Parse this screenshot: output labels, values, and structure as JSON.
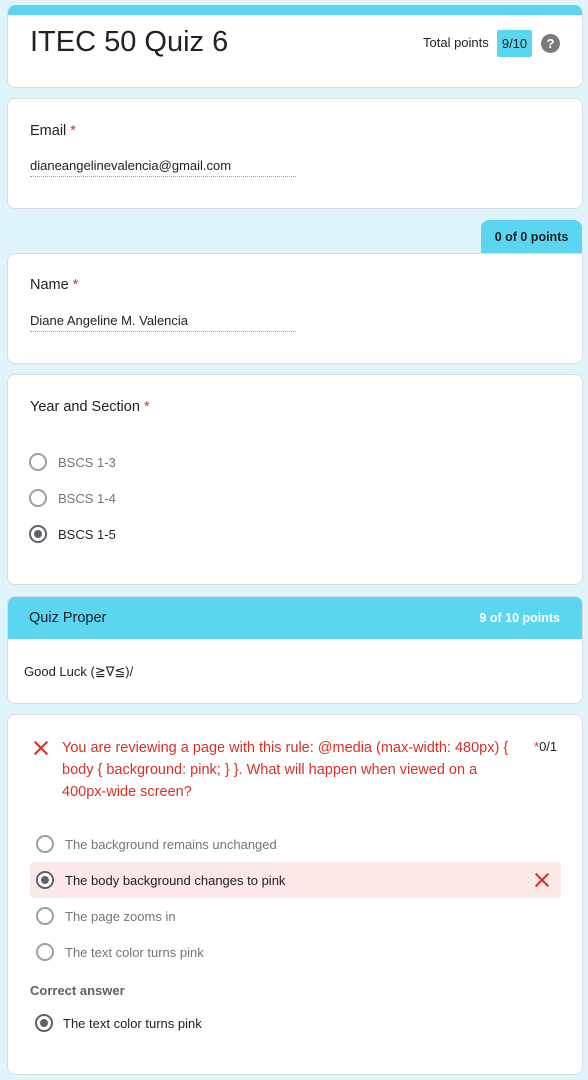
{
  "header": {
    "title": "ITEC 50 Quiz 6",
    "total_label": "Total points",
    "total_score": "9/10",
    "help_symbol": "?"
  },
  "email": {
    "label": "Email",
    "required": "*",
    "value": "dianeangelinevalencia@gmail.com"
  },
  "points_tab": "0 of 0 points",
  "name": {
    "label": "Name",
    "required": "*",
    "value": "Diane Angeline M. Valencia"
  },
  "year_section": {
    "label": "Year and Section",
    "required": "*",
    "options": [
      "BSCS 1-3",
      "BSCS 1-4",
      "BSCS 1-5"
    ],
    "selected": "BSCS 1-5"
  },
  "section": {
    "title": "Quiz Proper",
    "points": "9 of 10 points",
    "description": "Good Luck (≧∇≦)/"
  },
  "question": {
    "text": "You are reviewing a page with this rule: @media (max-width: 480px) { body { background: pink; } }. What will happen when viewed on a 400px-wide screen?",
    "required": "*",
    "score": "0/1",
    "options": [
      "The background remains unchanged",
      "The body background changes to pink",
      "The page zooms in",
      "The text color turns pink"
    ],
    "selected": "The body background changes to pink",
    "correct_label": "Correct answer",
    "correct_answer": "The text color turns pink"
  },
  "colors": {
    "accent": "#5cd5f0",
    "page_bg": "#dff4fb",
    "error": "#d93025",
    "error_bg": "#fce8e6"
  }
}
